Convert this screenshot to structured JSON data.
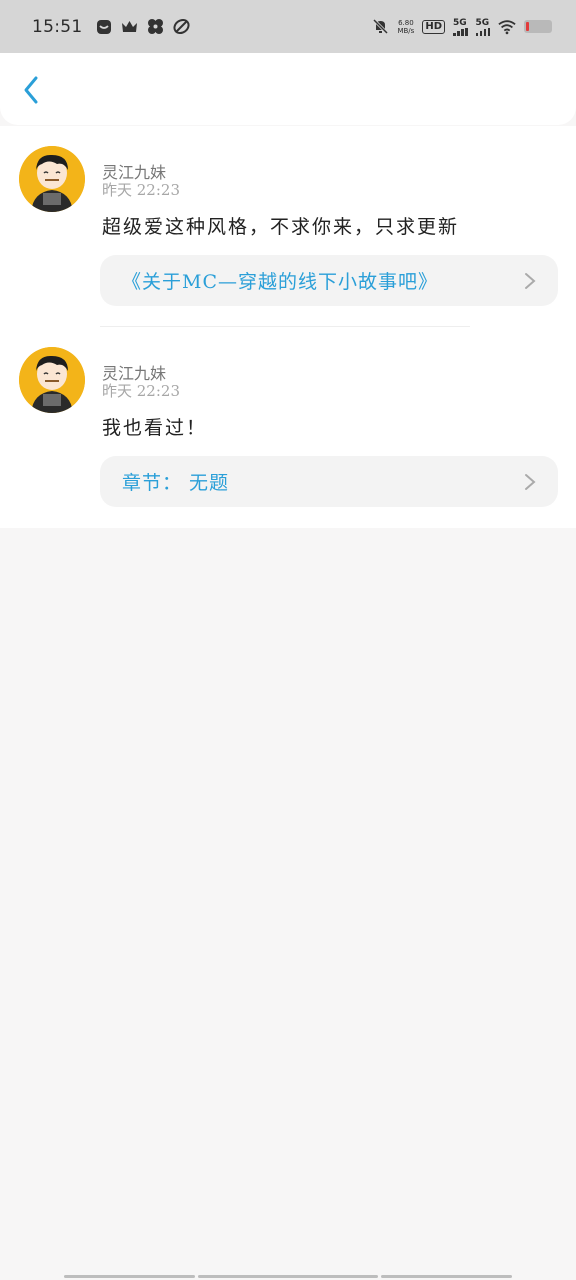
{
  "status_bar": {
    "time": "15:51",
    "net_speed_value": "6.80",
    "net_speed_unit": "MB/s",
    "hd_label": "HD",
    "sig1": "5G",
    "sig2": "5G",
    "icons": [
      "notification-icon",
      "crown-icon",
      "pinwheel-icon",
      "leaf-icon",
      "mute-bell-icon",
      "wifi-icon",
      "battery-icon"
    ]
  },
  "header": {
    "back_icon": "back-chevron-icon"
  },
  "comments": [
    {
      "name": "灵江九妹",
      "time": "昨天 22:23",
      "content": "超级爱这种风格，不求你来，只求更新",
      "link": "《关于MC—穿越的线下小故事吧》"
    },
    {
      "name": "灵江九妹",
      "time": "昨天 22:23",
      "content": "我也看过！",
      "link": "章节： 无题"
    }
  ],
  "colors": {
    "accent": "#2a9fd8",
    "avatar_bg": "#f3b419",
    "battery_low": "#e23b3b"
  }
}
